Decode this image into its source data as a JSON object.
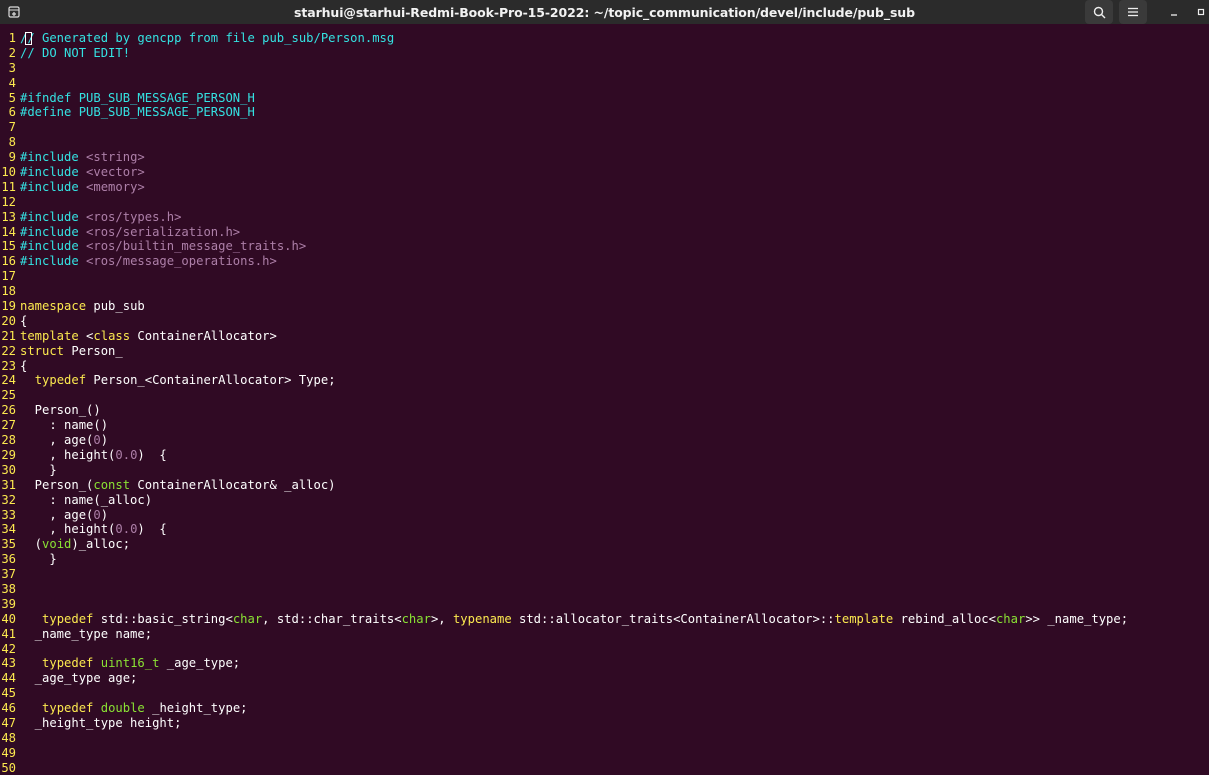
{
  "window": {
    "title": "starhui@starhui-Redmi-Book-Pro-15-2022: ~/topic_communication/devel/include/pub_sub",
    "icons": [
      "terminal-tab-icon",
      "search-icon",
      "menu-icon",
      "minimize-icon",
      "maximize-icon"
    ]
  },
  "editor": {
    "lines": [
      "// Generated by gencpp from file pub_sub/Person.msg",
      "// DO NOT EDIT!",
      "",
      "",
      "#ifndef PUB_SUB_MESSAGE_PERSON_H",
      "#define PUB_SUB_MESSAGE_PERSON_H",
      "",
      "",
      "#include <string>",
      "#include <vector>",
      "#include <memory>",
      "",
      "#include <ros/types.h>",
      "#include <ros/serialization.h>",
      "#include <ros/builtin_message_traits.h>",
      "#include <ros/message_operations.h>",
      "",
      "",
      "namespace pub_sub",
      "{",
      "template <class ContainerAllocator>",
      "struct Person_",
      "{",
      "  typedef Person_<ContainerAllocator> Type;",
      "",
      "  Person_()",
      "    : name()",
      "    , age(0)",
      "    , height(0.0)  {",
      "    }",
      "  Person_(const ContainerAllocator& _alloc)",
      "    : name(_alloc)",
      "    , age(0)",
      "    , height(0.0)  {",
      "  (void)_alloc;",
      "    }",
      "",
      "",
      "",
      "   typedef std::basic_string<char, std::char_traits<char>, typename std::allocator_traits<ContainerAllocator>::template rebind_alloc<char>> _name_type;",
      "  _name_type name;",
      "",
      "   typedef uint16_t _age_type;",
      "  _age_type age;",
      "",
      "   typedef double _height_type;",
      "  _height_type height;",
      "",
      "",
      ""
    ]
  },
  "colors": {
    "background": "#300a24",
    "line_number": "#fce94f",
    "comment": "#34e2e2",
    "string": "#ad7fa8",
    "keyword": "#fce94f",
    "type": "#8ae234",
    "text": "#ffffff"
  }
}
